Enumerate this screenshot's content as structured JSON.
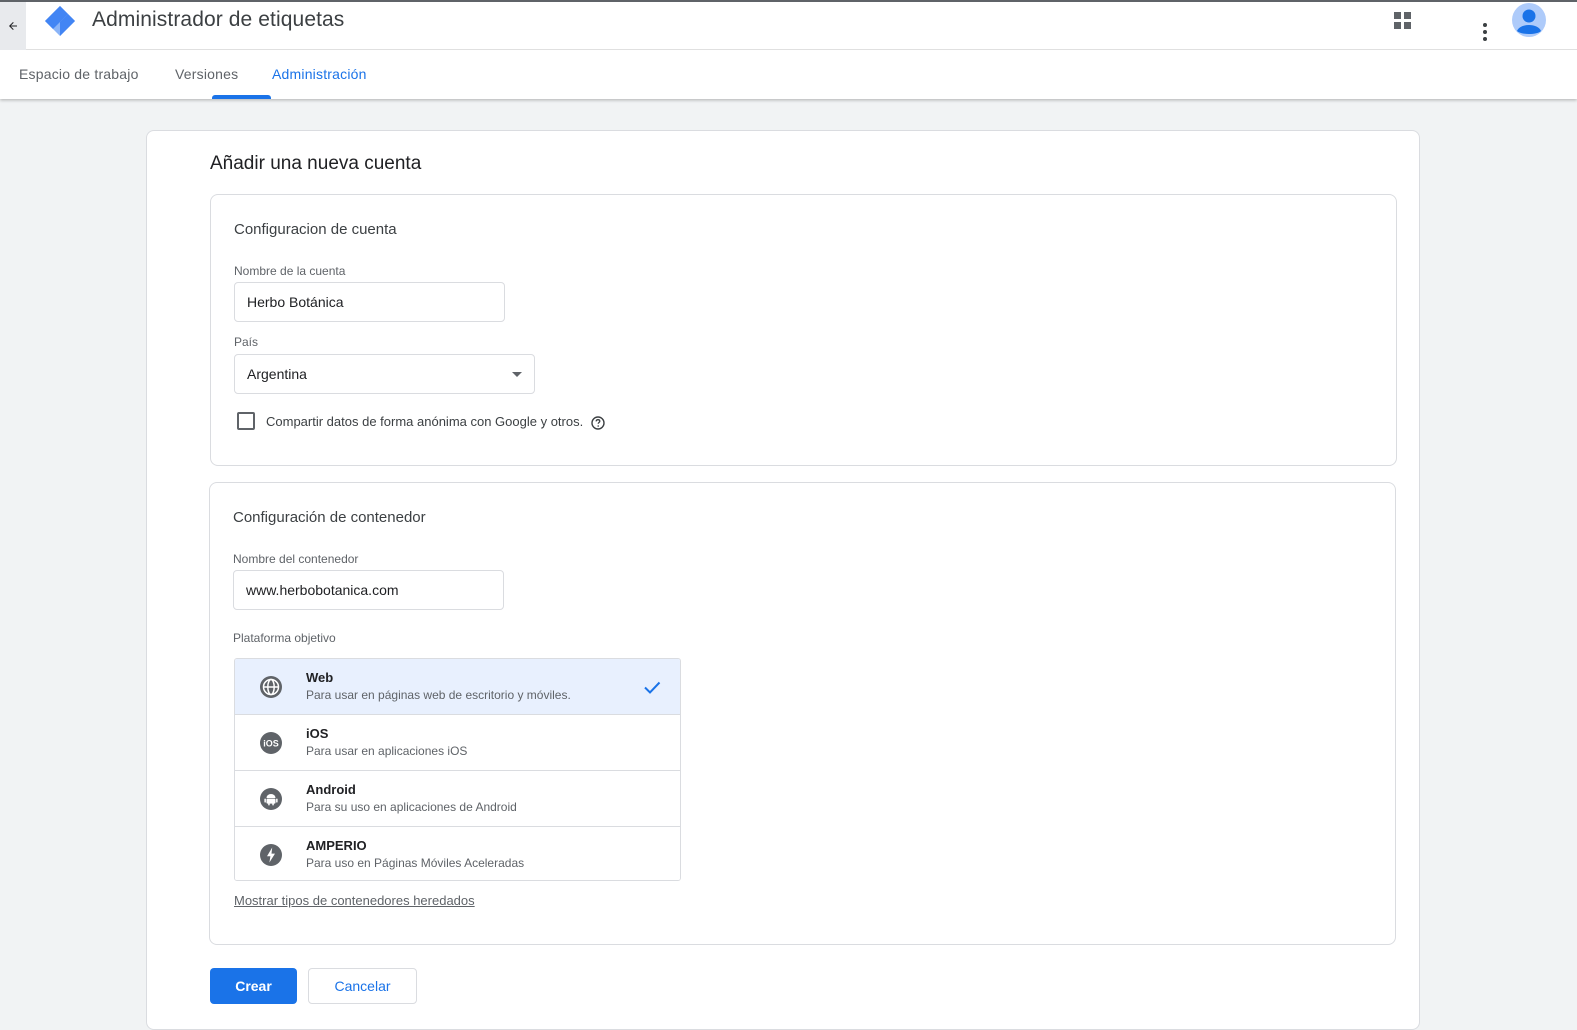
{
  "app": {
    "title": "Administrador de etiquetas",
    "brand_colors": {
      "logo_primary": "#4285f4",
      "logo_secondary": "#8ab4f8",
      "accent": "#1a73e8"
    }
  },
  "header": {
    "icons": {
      "back": "arrow-back-icon",
      "apps": "apps-grid-icon",
      "more": "more-vert-icon",
      "account": "account-avatar-icon"
    }
  },
  "tabs": [
    {
      "label": "Espacio de trabajo",
      "active": false
    },
    {
      "label": "Versiones",
      "active": false
    },
    {
      "label": "Administración",
      "active": true
    }
  ],
  "page": {
    "title": "Añadir una nueva cuenta"
  },
  "account_section": {
    "title": "Configuracion de cuenta",
    "account_name_label": "Nombre de la cuenta",
    "account_name_value": "Herbo Botánica",
    "country_label": "País",
    "country_value": "Argentina",
    "share_data_label": "Compartir datos de forma anónima con Google y otros.",
    "share_data_checked": false
  },
  "container_section": {
    "title": "Configuración de contenedor",
    "container_name_label": "Nombre del contenedor",
    "container_name_value": "www.herbobotanica.com",
    "platform_label": "Plataforma objetivo",
    "platforms": [
      {
        "name": "Web",
        "description": "Para usar en páginas web de escritorio y móviles.",
        "icon": "globe-icon",
        "selected": true
      },
      {
        "name": "iOS",
        "description": "Para usar en aplicaciones iOS",
        "icon": "ios-icon",
        "selected": false
      },
      {
        "name": "Android",
        "description": "Para su uso en aplicaciones de Android",
        "icon": "android-icon",
        "selected": false
      },
      {
        "name": "AMPERIO",
        "description": "Para uso en Páginas Móviles Aceleradas",
        "icon": "amp-bolt-icon",
        "selected": false
      }
    ],
    "legacy_link": "Mostrar tipos de contenedores heredados"
  },
  "actions": {
    "create_label": "Crear",
    "cancel_label": "Cancelar"
  }
}
